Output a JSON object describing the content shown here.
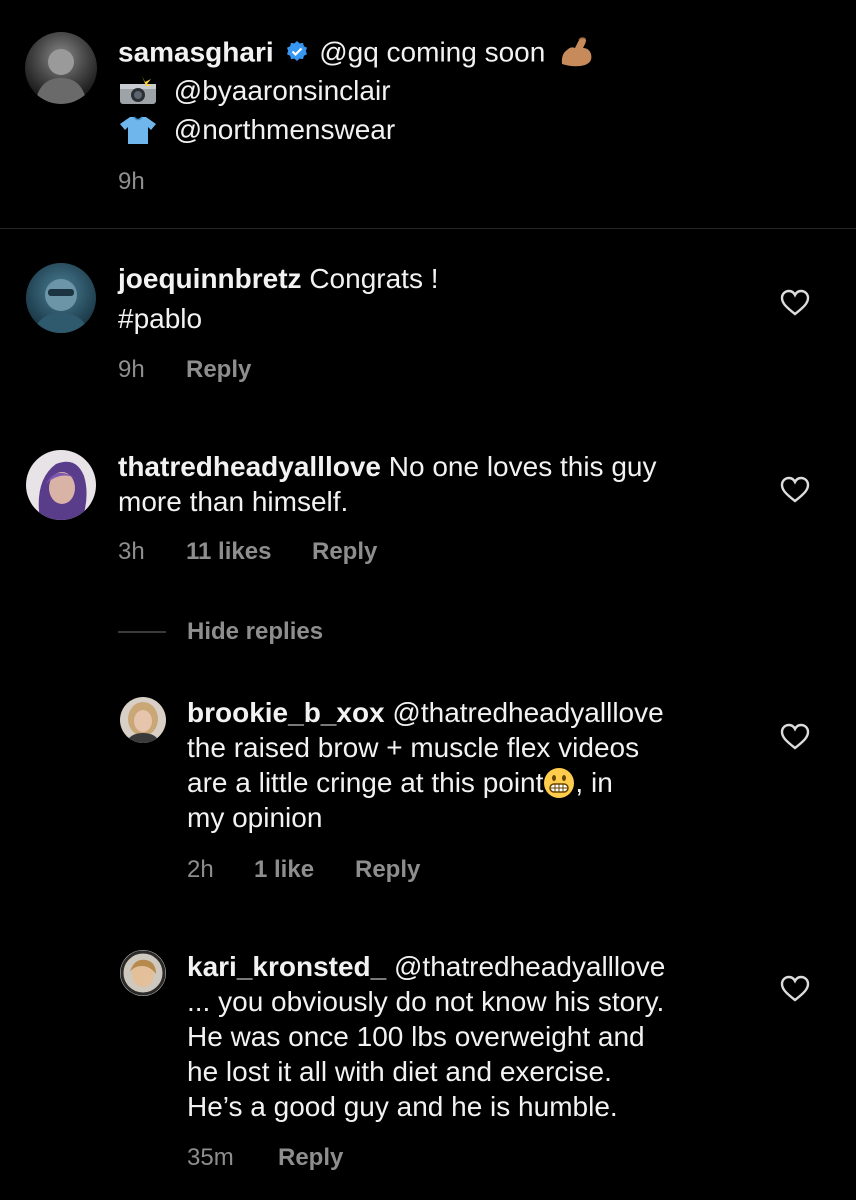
{
  "caption": {
    "username": "samasghari",
    "verified_icon": "verified-badge-icon",
    "line1_text": "@gq coming soon",
    "line1_emoji": "flexed-biceps",
    "line2_emoji": "camera-with-flash",
    "line2_text": "@byaaronsinclair",
    "line3_emoji": "t-shirt",
    "line3_text": "@northmenswear",
    "time": "9h"
  },
  "comments": [
    {
      "username": "joequinnbretz",
      "lines": [
        "Congrats !",
        "#pablo"
      ],
      "time": "9h",
      "reply_label": "Reply"
    },
    {
      "username": "thatredheadyalllove",
      "lines": [
        "No one loves this guy",
        "more than himself."
      ],
      "time": "3h",
      "likes": "11 likes",
      "reply_label": "Reply",
      "hide_replies_label": "Hide replies",
      "replies": [
        {
          "username": "brookie_b_xox",
          "lines": [
            "@thatredheadyalllove",
            "the raised brow + muscle flex videos",
            "are a little cringe at this point",
            ", in",
            "my opinion"
          ],
          "emoji": "grimacing-face",
          "time": "2h",
          "likes": "1 like",
          "reply_label": "Reply"
        },
        {
          "username": "kari_kronsted_",
          "lines": [
            "@thatredheadyalllove",
            "... you obviously do not know his story.",
            "He was once 100 lbs overweight and",
            "he lost it all with diet and exercise.",
            "He’s a good guy and he is humble."
          ],
          "time": "35m",
          "reply_label": "Reply"
        }
      ]
    }
  ]
}
